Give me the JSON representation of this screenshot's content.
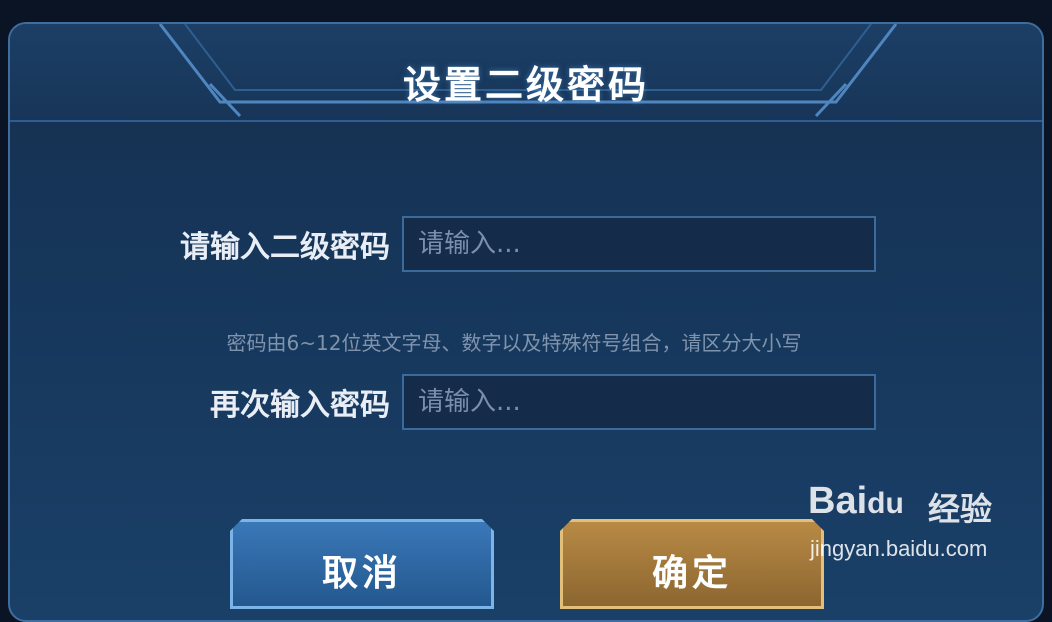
{
  "dialog": {
    "title": "设置二级密码",
    "password_label": "请输入二级密码",
    "password_placeholder": "请输入...",
    "hint": "密码由6~12位英文字母、数字以及特殊符号组合，请区分大小写",
    "confirm_label": "再次输入密码",
    "confirm_placeholder": "请输入...",
    "cancel_button": "取消",
    "ok_button": "确定"
  },
  "watermark": {
    "brand": "Bai",
    "brand_paw": "du",
    "brand_suffix": "经验",
    "url": "jingyan.baidu.com"
  },
  "colors": {
    "background": "#16365a",
    "frame": "#3f6e9e",
    "cancel": "#2f6aa6",
    "ok": "#a77c3d"
  }
}
